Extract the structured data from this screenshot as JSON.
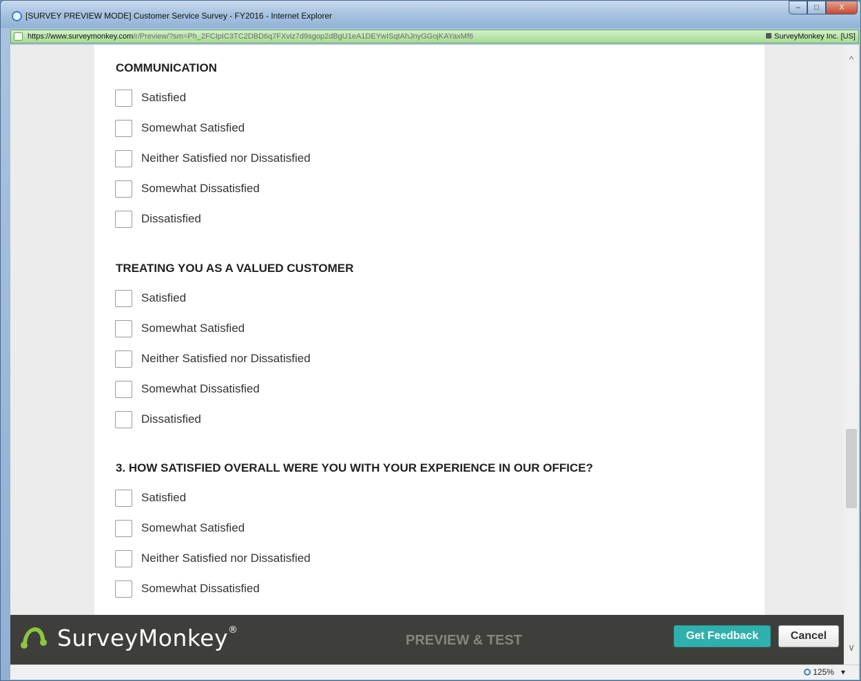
{
  "window": {
    "title": "[SURVEY PREVIEW MODE] Customer Service Survey - FY2016 - Internet Explorer",
    "minimize": "–",
    "maximize": "□",
    "close": "X"
  },
  "address_bar": {
    "prefix": "https://www.",
    "host": "surveymonkey.com",
    "path": "/r/Preview/?sm=Ph_2FCIpIC3TC2DBD6q7FXviz7d9sgop2dBgU1eA1DEYwISqtAhJnyGGojKAYaxMf6",
    "site_identity": "SurveyMonkey Inc. [US]"
  },
  "questions": [
    {
      "title": "COMMUNICATION",
      "options": [
        "Satisfied",
        "Somewhat Satisfied",
        "Neither Satisfied nor Dissatisfied",
        "Somewhat Dissatisfied",
        "Dissatisfied"
      ]
    },
    {
      "title": "TREATING YOU AS A VALUED CUSTOMER",
      "options": [
        "Satisfied",
        "Somewhat Satisfied",
        "Neither Satisfied nor Dissatisfied",
        "Somewhat Dissatisfied",
        "Dissatisfied"
      ]
    },
    {
      "title": "3. HOW SATISFIED OVERALL WERE YOU WITH YOUR EXPERIENCE IN OUR OFFICE?",
      "options": [
        "Satisfied",
        "Somewhat Satisfied",
        "Neither Satisfied nor Dissatisfied",
        "Somewhat Dissatisfied"
      ]
    }
  ],
  "preview_bar": {
    "logo_text": "SurveyMonkey",
    "registered_mark": "®",
    "mode_label": "PREVIEW & TEST",
    "feedback_button": "Get Feedback",
    "cancel_button": "Cancel"
  },
  "scrollbar": {
    "up_arrow": "^",
    "down_arrow": "∨"
  },
  "status_bar": {
    "zoom": "125%",
    "zoom_dropdown": "▾"
  },
  "colors": {
    "feedback_button": "#2fb0ad",
    "preview_bar": "#3e3f3a",
    "logo_mark": "#8dc63f"
  }
}
